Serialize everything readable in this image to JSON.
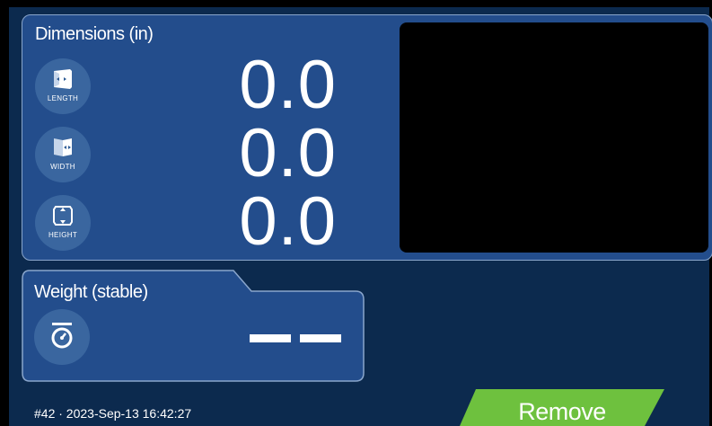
{
  "dimensions": {
    "title": "Dimensions  (in)",
    "rows": [
      {
        "label": "LENGTH",
        "value": "0.0",
        "icon": "length-icon"
      },
      {
        "label": "WIDTH",
        "value": "0.0",
        "icon": "width-icon"
      },
      {
        "label": "HEIGHT",
        "value": "0.0",
        "icon": "height-icon"
      }
    ]
  },
  "weight": {
    "title": "Weight  (stable)",
    "value_display": "— —",
    "icon": "scale-icon"
  },
  "footer": {
    "info": "#42 · 2023-Sep-13 16:42:27"
  },
  "actions": {
    "remove_label": "Remove"
  },
  "colors": {
    "background": "#0c2a4e",
    "panel": "#234d8c",
    "panel_border": "#8aa6cc",
    "icon_circle": "#3a669f",
    "remove_button": "#6ec13e",
    "camera_view": "#000000"
  }
}
